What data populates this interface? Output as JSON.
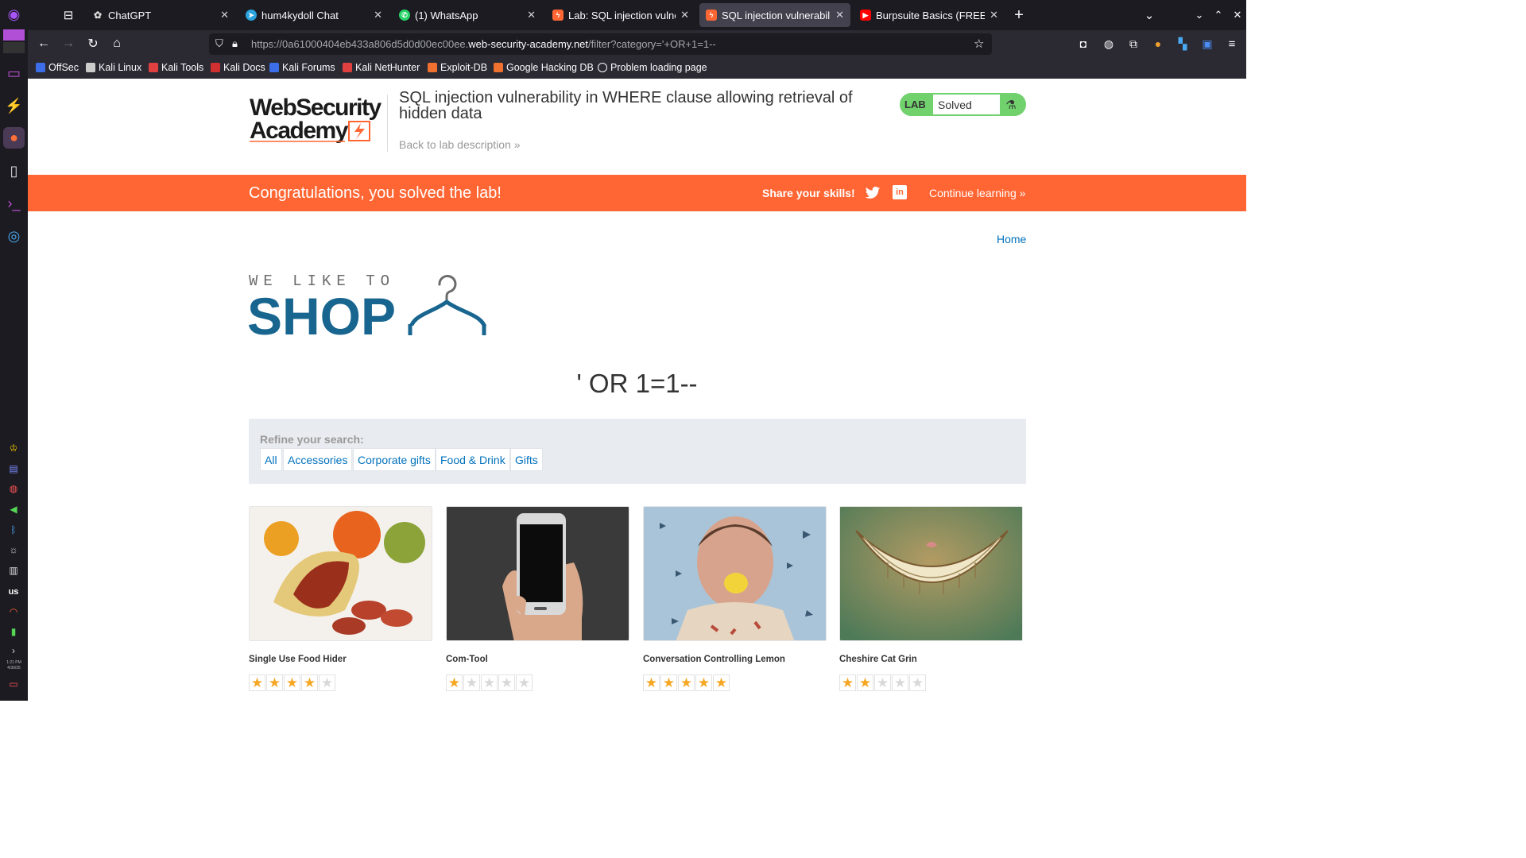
{
  "browser": {
    "tabs": [
      {
        "title": "ChatGPT",
        "favicon": "chatgpt-icon",
        "active": false
      },
      {
        "title": "hum4kydoll Chat",
        "favicon": "telegram-icon",
        "active": false
      },
      {
        "title": "(1) WhatsApp",
        "favicon": "whatsapp-icon",
        "active": false
      },
      {
        "title": "Lab: SQL injection vulnerab",
        "favicon": "portswigger-icon",
        "active": false
      },
      {
        "title": "SQL injection vulnerability i",
        "favicon": "portswigger-icon",
        "active": true
      },
      {
        "title": "Burpsuite Basics (FREE Cou",
        "favicon": "youtube-icon",
        "active": false
      }
    ],
    "url_prefix": "https://0a61000404eb433a806d5d0d00ec00ee.",
    "url_domain": "web-security-academy.net",
    "url_path": "/filter?category='+OR+1=1--",
    "bookmarks": [
      "OffSec",
      "Kali Linux",
      "Kali Tools",
      "Kali Docs",
      "Kali Forums",
      "Kali NetHunter",
      "Exploit-DB",
      "Google Hacking DB",
      "Problem loading page"
    ]
  },
  "dock": {
    "keyboard_layout": "us",
    "time": "1:21 PM",
    "date": "4/30/25"
  },
  "header": {
    "logo_line1": "WebSecurity",
    "logo_line2": "Academy",
    "lab_title": "SQL injection vulnerability in WHERE clause allowing retrieval of hidden data",
    "back_link": "Back to lab description",
    "lab_badge": "LAB",
    "lab_status": "Solved"
  },
  "banner": {
    "message": "Congratulations, you solved the lab!",
    "share": "Share your skills!",
    "continue": "Continue learning"
  },
  "nav": {
    "home": "Home"
  },
  "shop": {
    "tagline": "WE LIKE TO",
    "name": "SHOP",
    "filter_heading": "' OR 1=1--",
    "refine_label": "Refine your search:",
    "categories": [
      "All",
      "Accessories",
      "Corporate gifts",
      "Food & Drink",
      "Gifts"
    ]
  },
  "products": [
    {
      "name": "Single Use Food Hider",
      "rating": 4
    },
    {
      "name": "Com-Tool",
      "rating": 1
    },
    {
      "name": "Conversation Controlling Lemon",
      "rating": 5
    },
    {
      "name": "Cheshire Cat Grin",
      "rating": 2
    }
  ],
  "colors": {
    "accent_orange": "#ff6633",
    "link_blue": "#0071bc",
    "lab_green": "#70d16d",
    "shop_blue": "#18658f"
  }
}
